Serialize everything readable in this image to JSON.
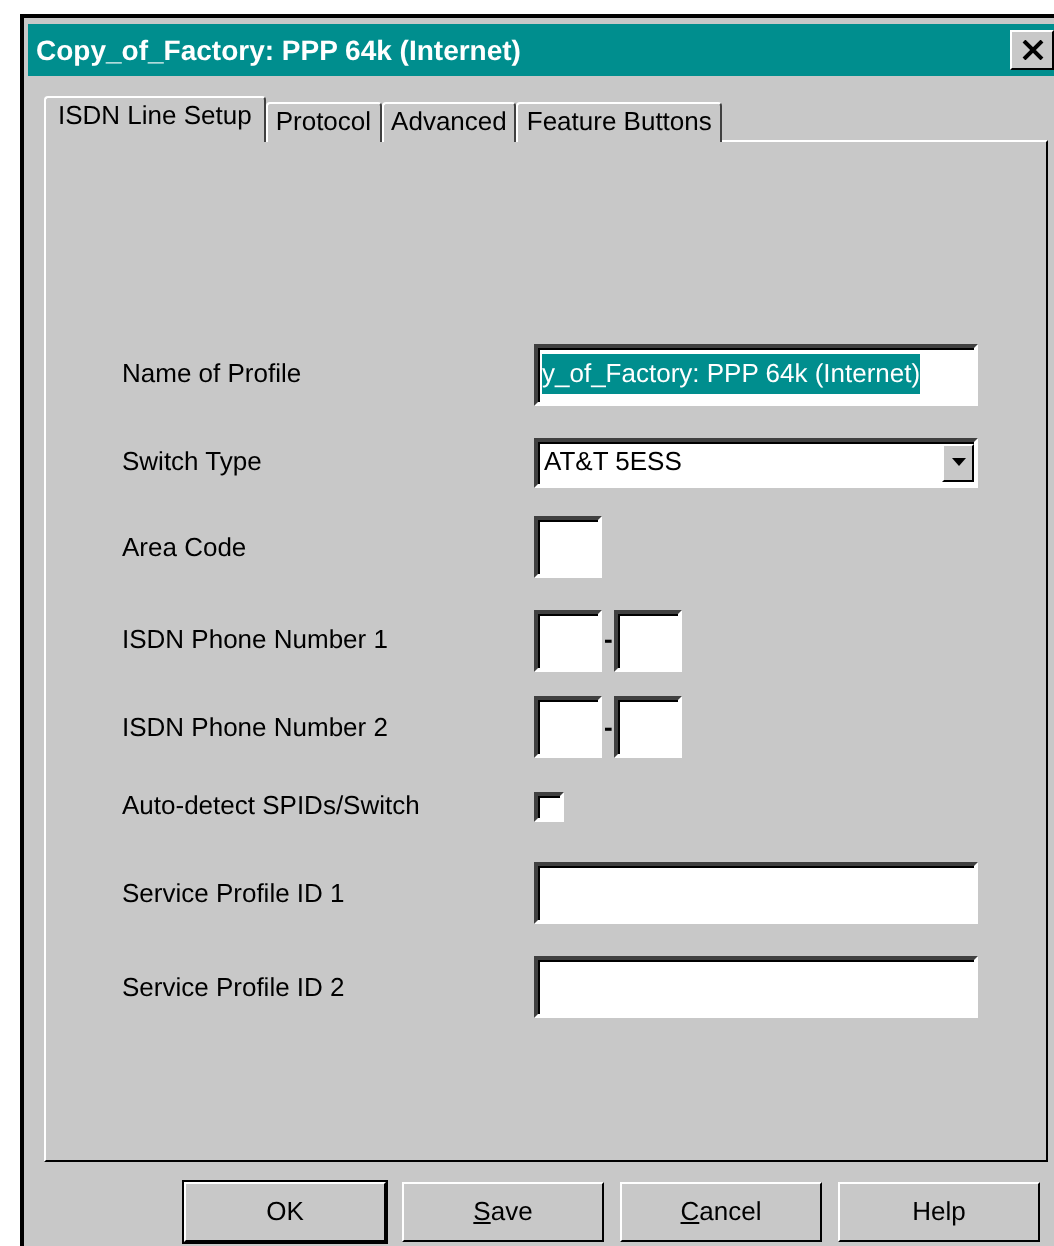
{
  "window": {
    "title": "Copy_of_Factory: PPP 64k (Internet)"
  },
  "tabs": [
    {
      "label": "ISDN Line Setup",
      "selected": true
    },
    {
      "label": "Protocol",
      "selected": false
    },
    {
      "label": "Advanced",
      "selected": false
    },
    {
      "label": "Feature Buttons",
      "selected": false
    }
  ],
  "fields": [
    {
      "kind": "text",
      "label": "Name of Profile",
      "value": "y_of_Factory: PPP 64k (Internet)",
      "text_selected": true
    },
    {
      "kind": "dropdown",
      "label": "Switch Type",
      "value": "AT&T 5ESS"
    },
    {
      "kind": "short",
      "label": "Area Code"
    },
    {
      "kind": "phone",
      "label": "ISDN Phone Number 1",
      "separator": "-"
    },
    {
      "kind": "phone",
      "label": "ISDN Phone Number 2",
      "separator": "-"
    },
    {
      "kind": "checkbox",
      "label": "Auto-detect SPIDs/Switch",
      "checked": false
    },
    {
      "kind": "text",
      "label": "Service Profile ID 1"
    },
    {
      "kind": "text",
      "label": "Service Profile ID 2"
    }
  ],
  "buttons": [
    {
      "label": "OK",
      "default": true,
      "underline_first": false
    },
    {
      "label": "Save",
      "default": false,
      "underline_first": true
    },
    {
      "label": "Cancel",
      "default": false,
      "underline_first": true
    },
    {
      "label": "Help",
      "default": false,
      "underline_first": false
    }
  ]
}
